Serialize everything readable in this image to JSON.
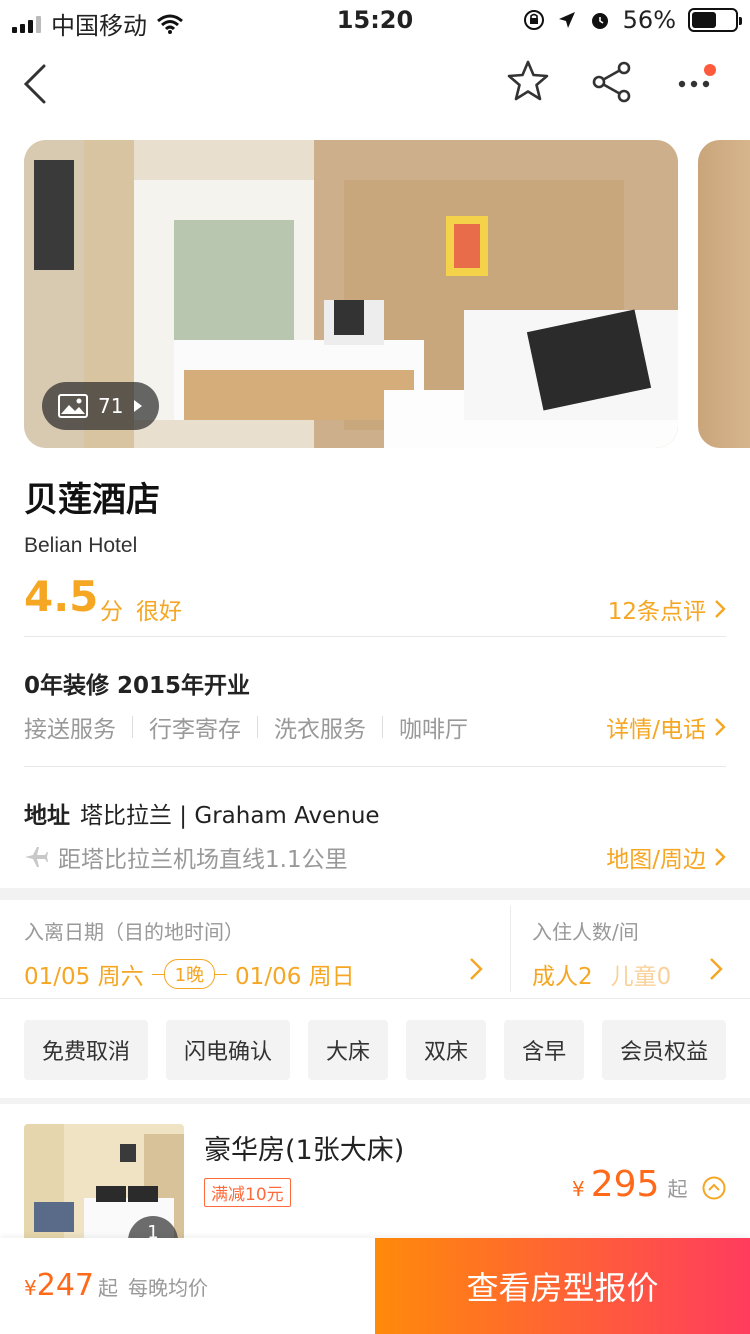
{
  "status_bar": {
    "carrier": "中国移动",
    "time": "15:20",
    "battery": "56%"
  },
  "nav": {
    "back_icon": "chevron-left-icon",
    "favorite_icon": "star-icon",
    "share_icon": "share-icon",
    "more_icon": "more-icon"
  },
  "gallery": {
    "photo_count": "71"
  },
  "hotel": {
    "name": "贝莲酒店",
    "name_en": "Belian Hotel",
    "score": "4.5",
    "score_unit": "分",
    "score_text": "很好",
    "reviews": "12条点评"
  },
  "info": {
    "title": "0年装修 2015年开业",
    "facilities": [
      "接送服务",
      "行李寄存",
      "洗衣服务",
      "咖啡厅"
    ],
    "detail_link": "详情/电话"
  },
  "address": {
    "label": "地址",
    "value": "塔比拉兰 | Graham Avenue",
    "distance": "距塔比拉兰机场直线1.1公里",
    "map_link": "地图/周边"
  },
  "dates": {
    "label": "入离日期（目的地时间）",
    "checkin": "01/05 周六",
    "nights": "1晚",
    "checkout": "01/06 周日"
  },
  "guests": {
    "label": "入住人数/间",
    "adults": "成人2",
    "children": "儿童0"
  },
  "filters": [
    "免费取消",
    "闪电确认",
    "大床",
    "双床",
    "含早",
    "会员权益"
  ],
  "room": {
    "name": "豪华房(1张大床)",
    "promo": "满减10元",
    "currency": "¥",
    "price": "295",
    "suffix": "起",
    "photo_badge": "1"
  },
  "bottom_bar": {
    "currency": "¥",
    "price": "247",
    "suffix": "起",
    "note": "每晚均价",
    "cta": "查看房型报价"
  },
  "colors": {
    "accent": "#f5a623",
    "price": "#ff6a1a",
    "cta_start": "#ff8a0a",
    "cta_end": "#ff3c5e"
  }
}
